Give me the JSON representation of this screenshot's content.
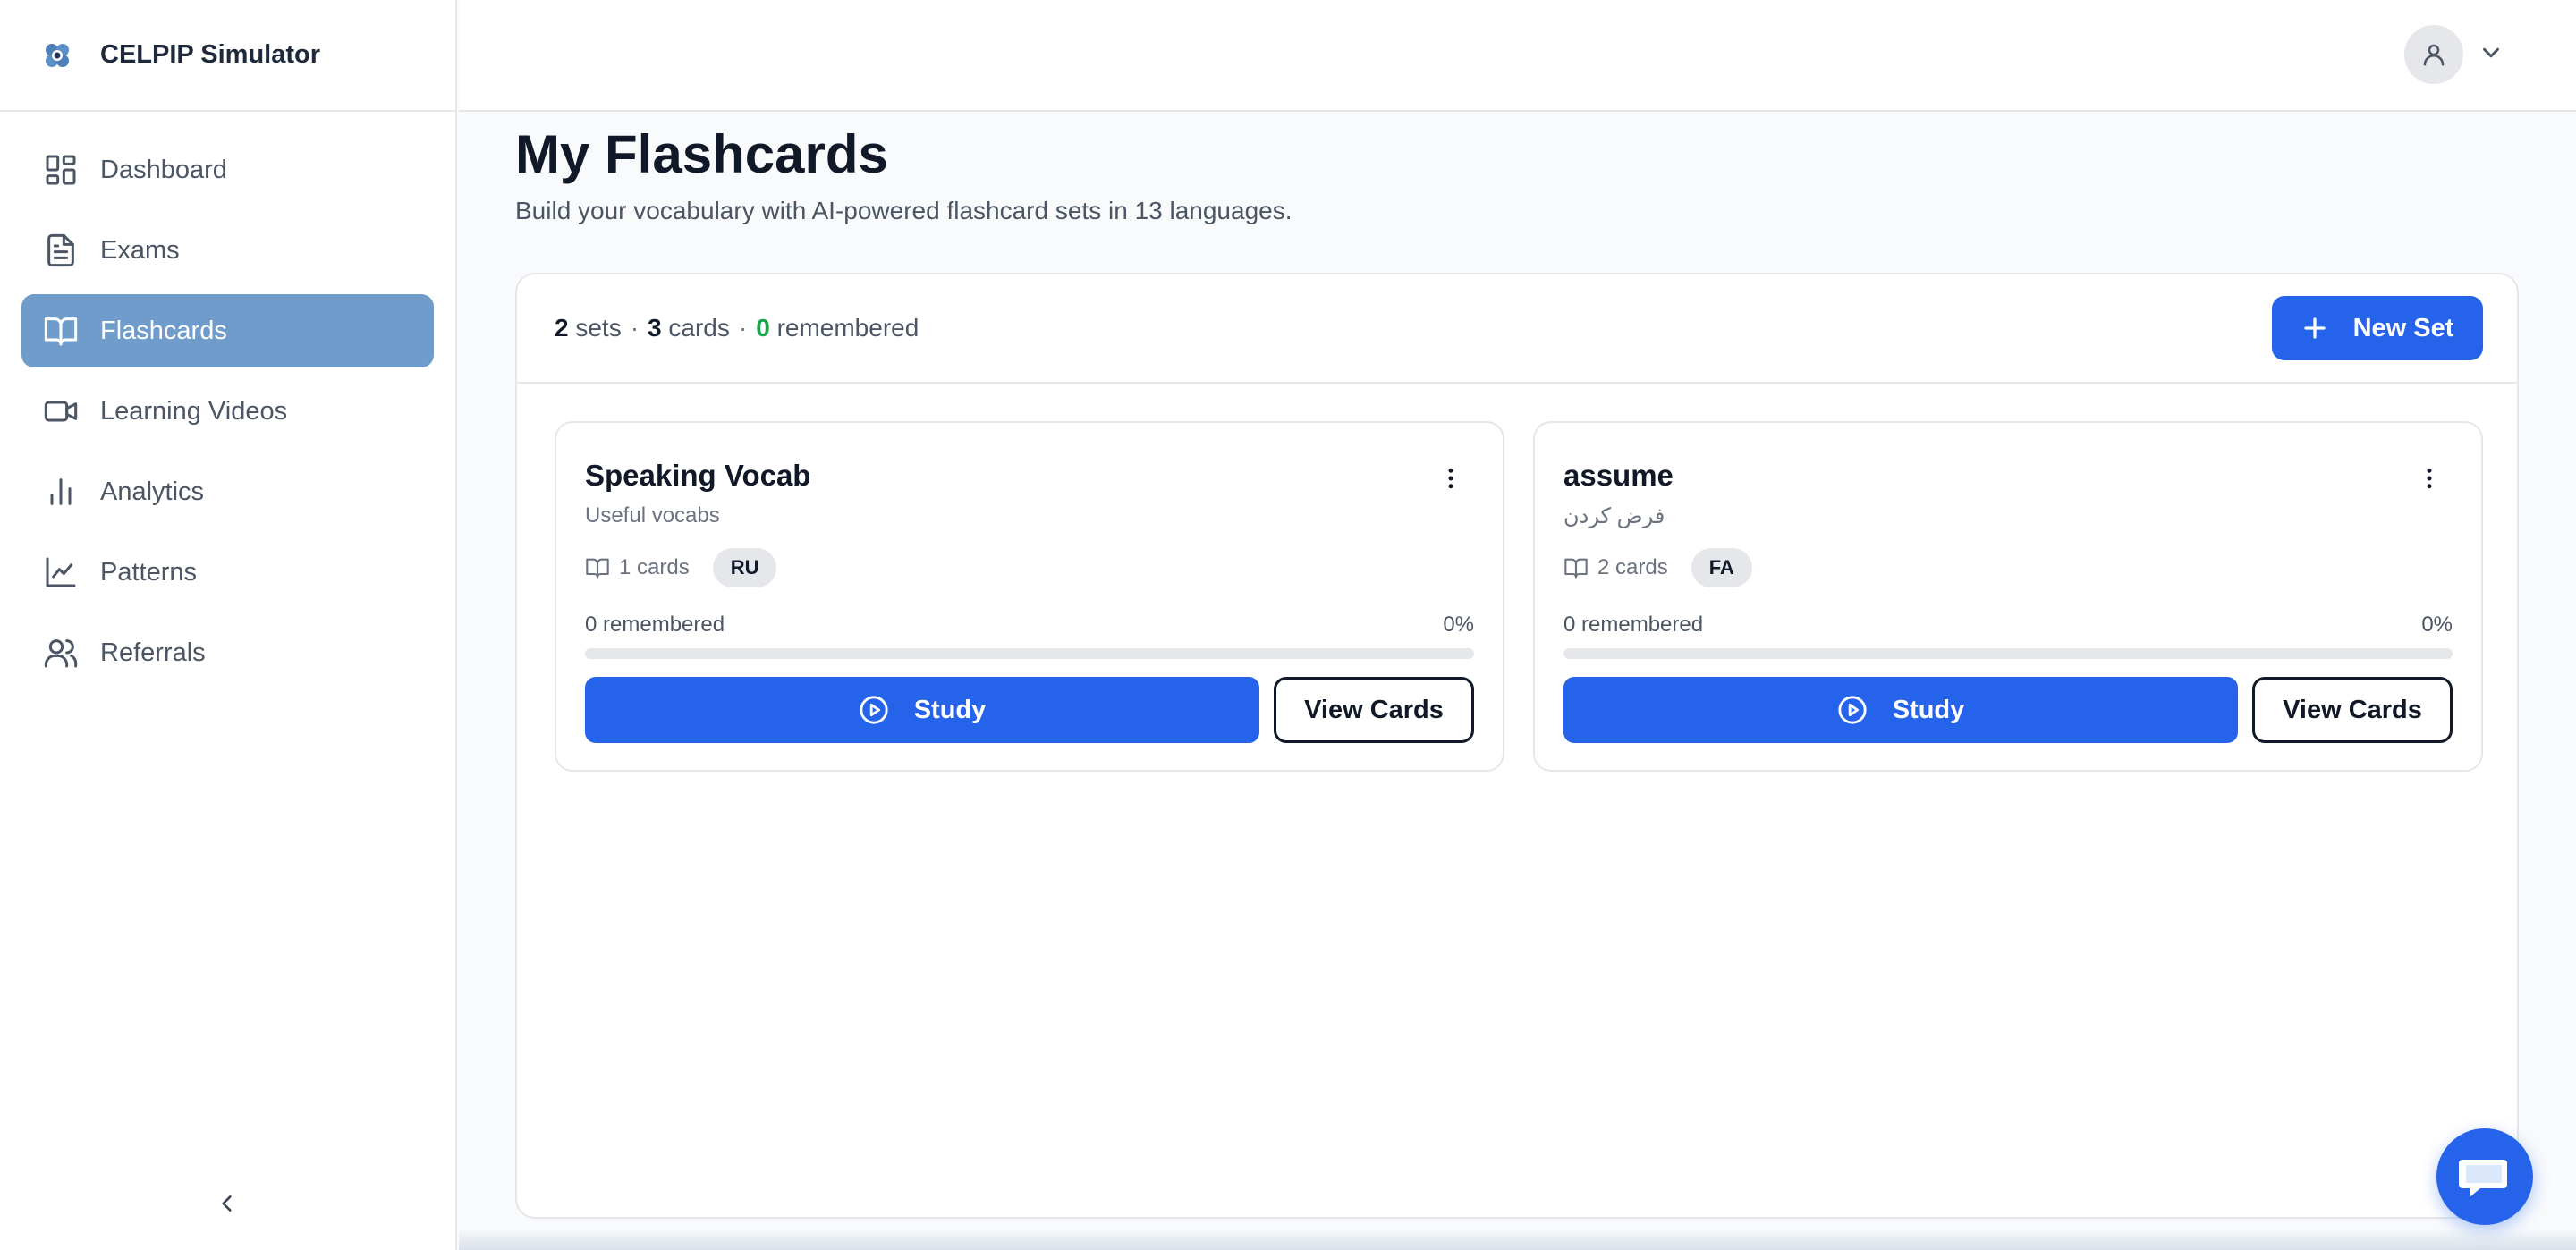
{
  "app": {
    "title": "CELPIP Simulator"
  },
  "sidebar": {
    "items": [
      {
        "label": "Dashboard",
        "icon": "dashboard-icon",
        "active": false
      },
      {
        "label": "Exams",
        "icon": "document-icon",
        "active": false
      },
      {
        "label": "Flashcards",
        "icon": "book-open-icon",
        "active": true
      },
      {
        "label": "Learning Videos",
        "icon": "video-icon",
        "active": false
      },
      {
        "label": "Analytics",
        "icon": "bar-chart-icon",
        "active": false
      },
      {
        "label": "Patterns",
        "icon": "line-chart-icon",
        "active": false
      },
      {
        "label": "Referrals",
        "icon": "users-icon",
        "active": false
      }
    ],
    "collapse_icon": "chevron-left-icon"
  },
  "header": {
    "user_icon": "user-icon",
    "menu_icon": "chevron-down-icon"
  },
  "page": {
    "title": "My Flashcards",
    "subtitle": "Build your vocabulary with AI-powered flashcard sets in 13 languages."
  },
  "summary": {
    "sets_count": "2",
    "sets_label": "sets",
    "cards_count": "3",
    "cards_label": "cards",
    "remembered_count": "0",
    "remembered_label": "remembered",
    "separator": "·",
    "new_set_label": "New Set"
  },
  "sets": [
    {
      "name": "Speaking Vocab",
      "description": "Useful vocabs",
      "cards_text": "1 cards",
      "language": "RU",
      "remembered_text": "0 remembered",
      "percent_text": "0%",
      "progress": 0,
      "study_label": "Study",
      "view_label": "View Cards"
    },
    {
      "name": "assume",
      "description": "فرض کردن",
      "cards_text": "2 cards",
      "language": "FA",
      "remembered_text": "0 remembered",
      "percent_text": "0%",
      "progress": 0,
      "study_label": "Study",
      "view_label": "View Cards"
    }
  ],
  "colors": {
    "primary": "#2563eb",
    "active_nav": "#6f9ccb",
    "remembered": "#16a34a"
  },
  "chat": {
    "icon": "chat-icon"
  }
}
